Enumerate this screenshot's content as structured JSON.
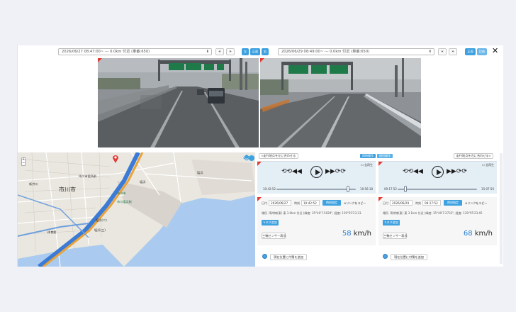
{
  "left": {
    "selector_value": "2026/06/27 08:47:00~ --- 0.0km 付近 (車番:650)",
    "prev_label": "«",
    "next_label": "»",
    "view_buttons": [
      "左",
      "正面",
      "右"
    ]
  },
  "right": {
    "selector_value": "2026/06/29 08:49:00~ --- 0.0km 付近 (車番:650)",
    "prev_label": "«",
    "next_label": "»",
    "view_buttons": [
      "正面",
      "比較"
    ],
    "close_label": "✕"
  },
  "panel": {
    "align_left_label": "«走行地点を左に合わせる",
    "align_right_label": "走行地点を左に合わせる»",
    "sync_tabs": [
      "同時操作",
      "個別操作"
    ]
  },
  "map": {
    "zoom_in": "+",
    "zoom_out": "−",
    "labels": [
      "市川市役所前",
      "市川市",
      "市川市",
      "塩浜",
      "塩浜",
      "市川塩浜駅",
      "体育館",
      "塩浜(三)",
      "新井川",
      "塩浜(二)"
    ]
  },
  "players": [
    {
      "checkbox_label": "全再生",
      "time_start": "10:42:52",
      "time_end": "10:56:18",
      "progress": 0.9,
      "date_label": "日付",
      "date_value": "2026/06/27",
      "time_label": "時刻",
      "time_value": "10:42:52",
      "time_set_button": "時刻指定",
      "copy_link_button": "リンクをコピー",
      "place_label": "場所",
      "place_value": "湾岸線(東) 東 3.0km 付近 (緯度: 35°40'7.5029\", 経度: 139°55'23.23",
      "tag_button": "タグ追加",
      "sensor_button": "三軸センサー表示",
      "speed_value": "58",
      "speed_unit": "km/h",
      "add_note_button": "現在位置に付箋を追加"
    },
    {
      "checkbox_label": "全再生",
      "time_start": "09:17:52",
      "time_end": "15:07:56",
      "progress": 0.1,
      "date_label": "日付",
      "date_value": "2026/06/29",
      "time_label": "時刻",
      "time_value": "09:17:52",
      "time_set_button": "時刻指定",
      "copy_link_button": "リンクをコピー",
      "place_label": "場所",
      "place_value": "湾岸線(東) 東 3.1km 付近 (緯度: 35°40'7.2732\", 経度: 139°55'23.45",
      "tag_button": "タグ追加",
      "sensor_button": "三軸センサー表示",
      "speed_value": "68",
      "speed_unit": "km/h",
      "add_note_button": "現在位置に付箋を追加"
    }
  ],
  "colors": {
    "accent": "#3ea1e0",
    "marker_red": "#e53935",
    "speed_blue": "#2a7fd0",
    "player_bg": "#e4eef5"
  }
}
